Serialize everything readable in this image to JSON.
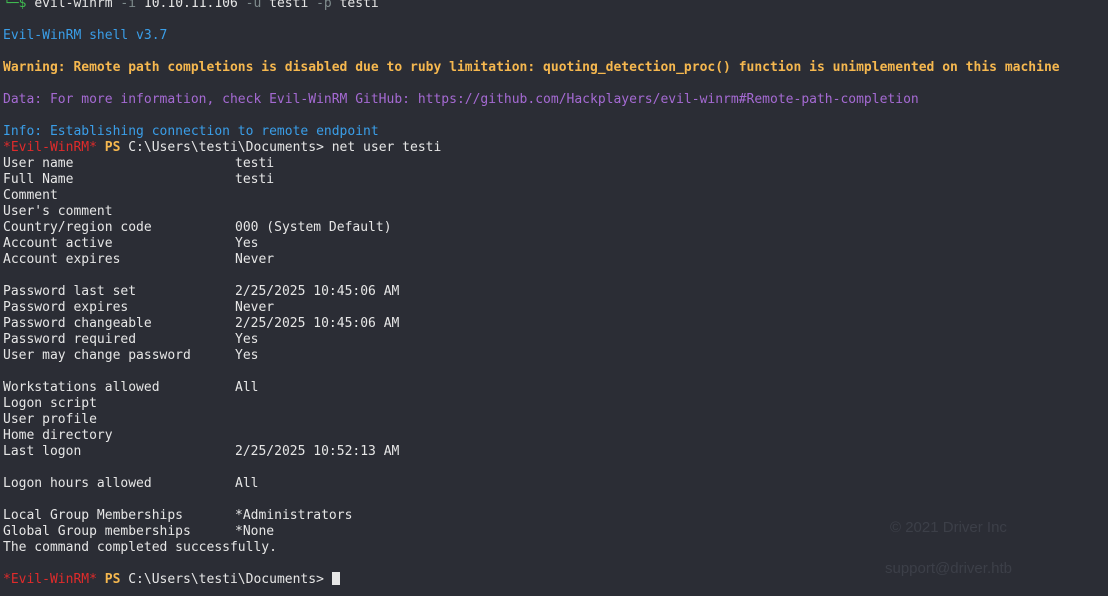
{
  "command_header": {
    "arrow": "└─$",
    "cmd": "evil-winrm",
    "flag_i": "-i",
    "ip": "10.10.11.106",
    "flag_u": "-u",
    "user": "testi",
    "flag_p": "-p",
    "pass": "testi"
  },
  "banner": {
    "shell": "Evil-WinRM shell v3.7",
    "warning": "Warning: Remote path completions is disabled due to ruby limitation: quoting_detection_proc() function is unimplemented on this machine",
    "data": "Data: For more information, check Evil-WinRM GitHub: https://github.com/Hackplayers/evil-winrm#Remote-path-completion",
    "info": "Info: Establishing connection to remote endpoint"
  },
  "prompt": {
    "name": "*Evil-WinRM*",
    "ps": "PS",
    "path": "C:\\Users\\testi\\Documents>",
    "command": "net user testi"
  },
  "user_info": [
    {
      "key": "User name",
      "value": "testi"
    },
    {
      "key": "Full Name",
      "value": "testi"
    },
    {
      "key": "Comment",
      "value": ""
    },
    {
      "key": "User's comment",
      "value": ""
    },
    {
      "key": "Country/region code",
      "value": "000 (System Default)"
    },
    {
      "key": "Account active",
      "value": "Yes"
    },
    {
      "key": "Account expires",
      "value": "Never"
    },
    {
      "key": "",
      "value": ""
    },
    {
      "key": "Password last set",
      "value": "2/25/2025 10:45:06 AM"
    },
    {
      "key": "Password expires",
      "value": "Never"
    },
    {
      "key": "Password changeable",
      "value": "2/25/2025 10:45:06 AM"
    },
    {
      "key": "Password required",
      "value": "Yes"
    },
    {
      "key": "User may change password",
      "value": "Yes"
    },
    {
      "key": "",
      "value": ""
    },
    {
      "key": "Workstations allowed",
      "value": "All"
    },
    {
      "key": "Logon script",
      "value": ""
    },
    {
      "key": "User profile",
      "value": ""
    },
    {
      "key": "Home directory",
      "value": ""
    },
    {
      "key": "Last logon",
      "value": "2/25/2025 10:52:13 AM"
    },
    {
      "key": "",
      "value": ""
    },
    {
      "key": "Logon hours allowed",
      "value": "All"
    },
    {
      "key": "",
      "value": ""
    },
    {
      "key": "Local Group Memberships",
      "value": "*Administrators"
    },
    {
      "key": "Global Group memberships",
      "value": "*None"
    }
  ],
  "completion": "The command completed successfully.",
  "watermark": {
    "copyright": "© 2021 Driver Inc",
    "support": "support@driver.htb"
  },
  "colors": {
    "background": "#2b2d35",
    "prompt_red": "#e02b2b",
    "ps_yellow": "#f6b84f",
    "info_blue": "#3a9ee8",
    "data_purple": "#a56ad3"
  }
}
